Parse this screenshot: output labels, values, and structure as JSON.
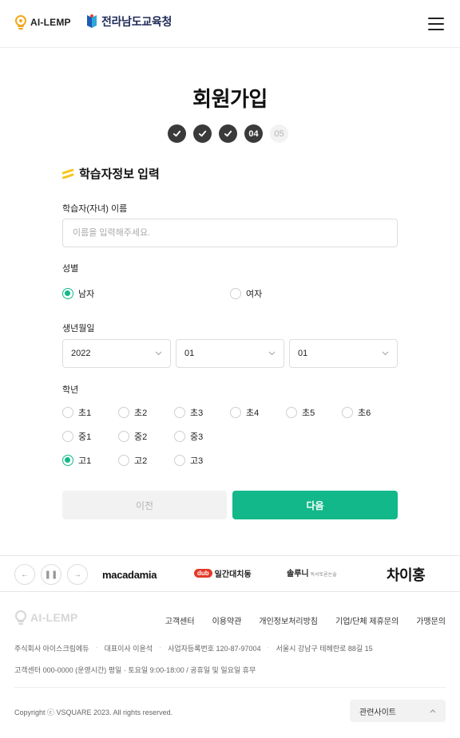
{
  "header": {
    "brand": "AI-LEMP",
    "partner": "전라남도교육청"
  },
  "page": {
    "title": "회원가입"
  },
  "steps": {
    "current": "04",
    "next": "05"
  },
  "section": {
    "title": "학습자정보 입력"
  },
  "form": {
    "name_label": "학습자(자녀) 이름",
    "name_placeholder": "이름을 입력해주세요.",
    "name_value": "",
    "gender_label": "성별",
    "gender_options": [
      "남자",
      "여자"
    ],
    "gender_selected": "남자",
    "birth_label": "생년월일",
    "birth_year": "2022",
    "birth_month": "01",
    "birth_day": "01",
    "grade_label": "학년",
    "grade_row1": [
      "초1",
      "초2",
      "초3",
      "초4",
      "초5",
      "초6"
    ],
    "grade_row2": [
      "중1",
      "중2",
      "중3"
    ],
    "grade_row3": [
      "고1",
      "고2",
      "고3"
    ],
    "grade_selected": "고1",
    "prev_button": "이전",
    "next_button": "다음"
  },
  "partners": {
    "logos": [
      "macadamia",
      "일간대치동",
      "솔루니",
      "독서토론논술",
      "차이홍"
    ]
  },
  "footer": {
    "brand": "AI-LEMP",
    "links": [
      "고객센터",
      "이용약관",
      "개인정보처리방침",
      "기업/단체 제휴문의",
      "가맹문의"
    ],
    "company": "주식회사 아이스크림에듀",
    "ceo": "대표이사 이윤석",
    "bizno": "사업자등록번호 120-87-97004",
    "address": "서울시 강남구 테헤란로 88길 15",
    "hours": "고객센터 000-0000 (운영시간) 평일 · 토요일 9:00-18:00 / 공휴일 및 일요일 휴무",
    "copyright": "Copyright ⓒ VSQUARE 2023. All rights reserved.",
    "related_sites": "관련사이트"
  },
  "colors": {
    "accent": "#12b88a",
    "step_done": "#3a3a3a",
    "highlight": "#f5c518"
  }
}
